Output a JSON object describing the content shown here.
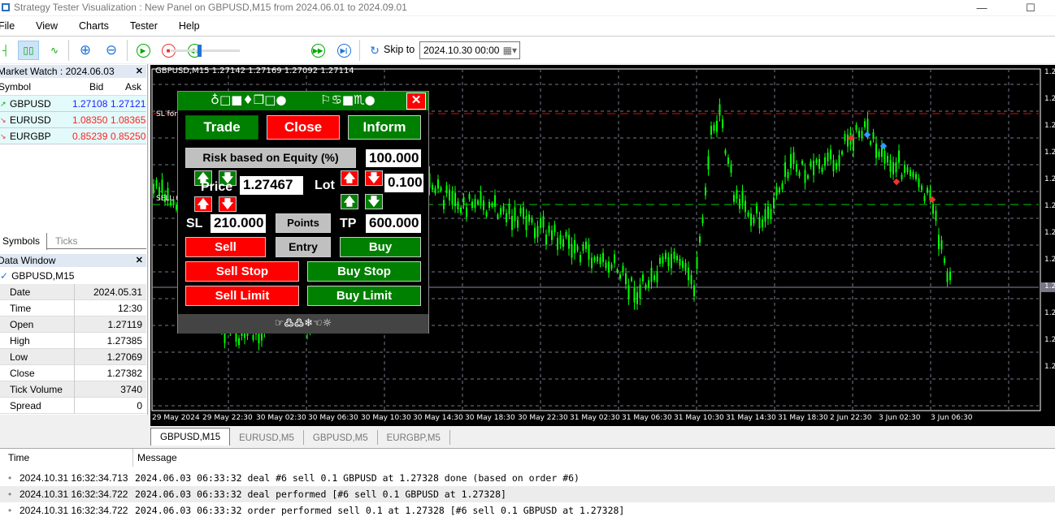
{
  "window": {
    "title": "Strategy Tester Visualization : New Panel on GBPUSD,M15 from 2024.06.01 to 2024.09.01",
    "minimize": "—",
    "maximize": "☐"
  },
  "menu": [
    "File",
    "View",
    "Charts",
    "Tester",
    "Help"
  ],
  "toolbar": {
    "skip_to_label": "Skip to",
    "skip_date": "2024.10.30 00:00",
    "speed_percent": 40
  },
  "market_watch": {
    "title": "Market Watch : 2024.06.03",
    "headers": [
      "Symbol",
      "Bid",
      "Ask"
    ],
    "rows": [
      {
        "symbol": "GBPUSD",
        "bid": "1.27108",
        "ask": "1.27121",
        "color": "#2020ff",
        "dir": "up"
      },
      {
        "symbol": "EURUSD",
        "bid": "1.08350",
        "ask": "1.08365",
        "color": "#ff2020",
        "dir": "down"
      },
      {
        "symbol": "EURGBP",
        "bid": "0.85239",
        "ask": "0.85250",
        "color": "#ff2020",
        "dir": "down"
      }
    ],
    "tabs": [
      "Symbols",
      "Ticks"
    ]
  },
  "data_window": {
    "title": "Data Window",
    "symbol": "GBPUSD,M15",
    "rows": [
      [
        "Date",
        "2024.05.31"
      ],
      [
        "Time",
        "12:30"
      ],
      [
        "Open",
        "1.27119"
      ],
      [
        "High",
        "1.27385"
      ],
      [
        "Low",
        "1.27069"
      ],
      [
        "Close",
        "1.27382"
      ],
      [
        "Tick Volume",
        "3740"
      ],
      [
        "Spread",
        "0"
      ]
    ]
  },
  "chart": {
    "info": "GBPUSD,M15  1.27142 1.27169 1.27092 1.27114",
    "sl_label": "SL for",
    "sell_label": "SELL 0",
    "price_tick_prefix": "1.2",
    "time_labels": [
      "29 May 2024",
      "29 May 22:30",
      "30 May 02:30",
      "30 May 06:30",
      "30 May 10:30",
      "30 May 14:30",
      "30 May 18:30",
      "30 May 22:30",
      "31 May 02:30",
      "31 May 06:30",
      "31 May 10:30",
      "31 May 14:30",
      "31 May 18:30",
      "2 Jun 22:30",
      "3 Jun 02:30",
      "3 Jun 06:30"
    ],
    "candle_color": "#00ff00",
    "background": "#000000"
  },
  "chart_tabs": [
    "GBPUSD,M15",
    "EURUSD,M5",
    "GBPUSD,M5",
    "EURGBP,M5"
  ],
  "panel": {
    "title_symbols_left": "♁□■♦❒□●",
    "title_symbols_right": "⚐♋■♏●",
    "close": "✕",
    "trade": "Trade",
    "close_btn": "Close",
    "inform": "Inform",
    "risk": "Risk based on Equity (%)",
    "risk_value": "100.000",
    "price_label": "Price",
    "price_value": "1.27467",
    "lot_label": "Lot",
    "lot_value": "0.100",
    "sl_label": "SL",
    "sl_value": "210.000",
    "points": "Points",
    "tp_label": "TP",
    "tp_value": "600.000",
    "sell": "Sell",
    "entry": "Entry",
    "buy": "Buy",
    "sell_stop": "Sell Stop",
    "buy_stop": "Buy Stop",
    "sell_limit": "Sell Limit",
    "buy_limit": "Buy Limit",
    "footer": "☞߷߷❄☜☼",
    "colors": {
      "green": "#008000",
      "red": "#ff0000",
      "gray": "#c0c0c0"
    }
  },
  "log": {
    "headers": [
      "Time",
      "Message"
    ],
    "rows": [
      [
        "2024.10.31 16:32:34.713",
        "2024.06.03 06:33:32   deal #6 sell 0.1 GBPUSD at 1.27328 done (based on order #6)"
      ],
      [
        "2024.10.31 16:32:34.722",
        "2024.06.03 06:33:32   deal performed [#6 sell 0.1 GBPUSD at 1.27328]"
      ],
      [
        "2024.10.31 16:32:34.722",
        "2024.06.03 06:33:32   order performed sell 0.1 at 1.27328 [#6 sell 0.1 GBPUSD at 1.27328]"
      ]
    ]
  }
}
